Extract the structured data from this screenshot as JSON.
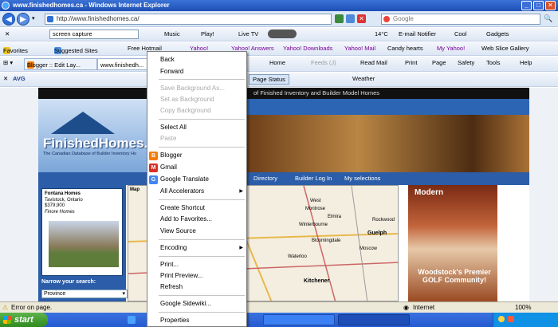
{
  "window": {
    "title": "www.finishedhomes.ca - Windows Internet Explorer"
  },
  "address": {
    "url": "http://www.finishedhomes.ca/",
    "search_placeholder": "Google"
  },
  "toolbar1": {
    "search_box": "screen capture",
    "items": [
      "Music",
      "Play!",
      "Live TV",
      "14°C",
      "E-mail Notifier",
      "Cool",
      "Gadgets"
    ]
  },
  "favbar": {
    "favorites": "Favorites",
    "items": [
      "Suggested Sites",
      "Free Hotmail",
      "Yahoo!",
      "Yahoo! Answers",
      "Yahoo! Downloads",
      "Yahoo! Mail",
      "Candy hearts",
      "My Yahoo!",
      "Web Slice Gallery"
    ]
  },
  "tabbar": {
    "tabs": [
      "Blogger :: Edit Lay...",
      "www.finishedh..."
    ],
    "cmd": [
      "Home",
      "Feeds (J)",
      "Read Mail",
      "Print",
      "Page",
      "Safety",
      "Tools",
      "Help"
    ]
  },
  "avgbar": {
    "label": "AVG",
    "page_status": "Page Status",
    "weather": "Weather"
  },
  "site": {
    "header_text": "of Finished Inventory and Builder Model Homes",
    "logo": "FinishedHomes.c",
    "tagline": "The Canadian Database of Builder Inventory Ho",
    "nav": [
      "Directory",
      "Builder Log In",
      "My selections"
    ],
    "feature": {
      "builder": "Fontana Homes",
      "location": "Tavistock, Ontario",
      "price": "$379,900",
      "brand": "Finore Homes"
    },
    "map_label": "Map",
    "map_places": [
      "West",
      "Montrose",
      "Elmira",
      "Winterbourne",
      "Guelph",
      "Bloomingdale",
      "Waterloo",
      "Kitchener",
      "Moscow",
      "Rockwood"
    ],
    "narrow_label": "Narrow your search:",
    "province_value": "Province",
    "ad": {
      "top": "Modern",
      "text": "Woodstock's Premier GOLF Community!"
    }
  },
  "context_menu": {
    "groups": [
      [
        {
          "label": "Back",
          "enabled": true
        },
        {
          "label": "Forward",
          "enabled": true
        }
      ],
      [
        {
          "label": "Save Background As...",
          "enabled": false
        },
        {
          "label": "Set as Background",
          "enabled": false
        },
        {
          "label": "Copy Background",
          "enabled": false
        }
      ],
      [
        {
          "label": "Select All",
          "enabled": true
        },
        {
          "label": "Paste",
          "enabled": false
        }
      ],
      [
        {
          "label": "Blogger",
          "enabled": true
        },
        {
          "label": "Gmail",
          "enabled": true
        },
        {
          "label": "Google Translate",
          "enabled": true
        },
        {
          "label": "All Accelerators",
          "enabled": true
        }
      ],
      [
        {
          "label": "Create Shortcut",
          "enabled": true
        },
        {
          "label": "Add to Favorites...",
          "enabled": true
        },
        {
          "label": "View Source",
          "enabled": true
        }
      ],
      [
        {
          "label": "Encoding",
          "enabled": true
        }
      ],
      [
        {
          "label": "Print...",
          "enabled": true
        },
        {
          "label": "Print Preview...",
          "enabled": true
        },
        {
          "label": "Refresh",
          "enabled": true
        }
      ],
      [
        {
          "label": "Google Sidewiki...",
          "enabled": true
        }
      ],
      [
        {
          "label": "Properties",
          "enabled": true
        }
      ]
    ]
  },
  "status": {
    "text": "Error on page.",
    "zone": "Internet",
    "zoom": "100%"
  },
  "taskbar": {
    "start": "start",
    "clock": ""
  },
  "colors": {
    "accent": "#245ad0",
    "site_blue": "#2b5da8"
  }
}
